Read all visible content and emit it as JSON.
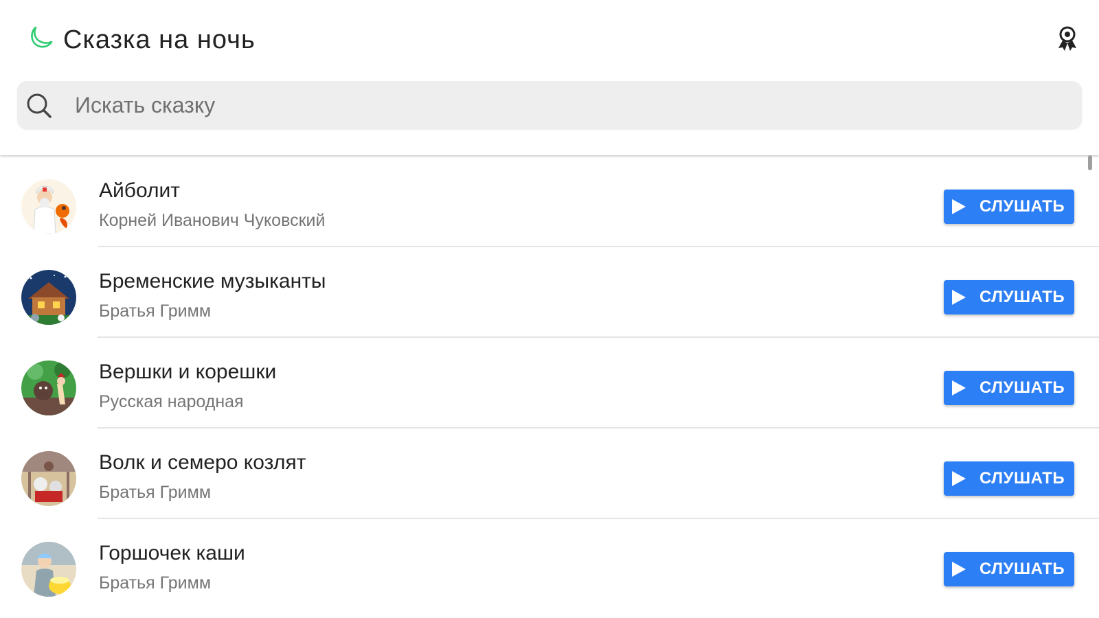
{
  "app": {
    "title": "Сказка на ночь",
    "accent_color": "#2ecc71",
    "button_color": "#2d7ff5"
  },
  "header": {
    "logo_icon": "crescent-moon-icon",
    "account_icon": "account-badge-icon"
  },
  "search": {
    "placeholder": "Искать сказку",
    "value": "",
    "icon": "search-icon"
  },
  "stories": [
    {
      "title": "Айболит",
      "author": "Корней Иванович Чуковский",
      "button_label": "СЛУШАТЬ"
    },
    {
      "title": "Бременские музыканты",
      "author": "Братья Гримм",
      "button_label": "СЛУШАТЬ"
    },
    {
      "title": "Вершки и корешки",
      "author": "Русская народная",
      "button_label": "СЛУШАТЬ"
    },
    {
      "title": "Волк и семеро козлят",
      "author": "Братья Гримм",
      "button_label": "СЛУШАТЬ"
    },
    {
      "title": "Горшочек каши",
      "author": "Братья Гримм",
      "button_label": "СЛУШАТЬ"
    }
  ]
}
